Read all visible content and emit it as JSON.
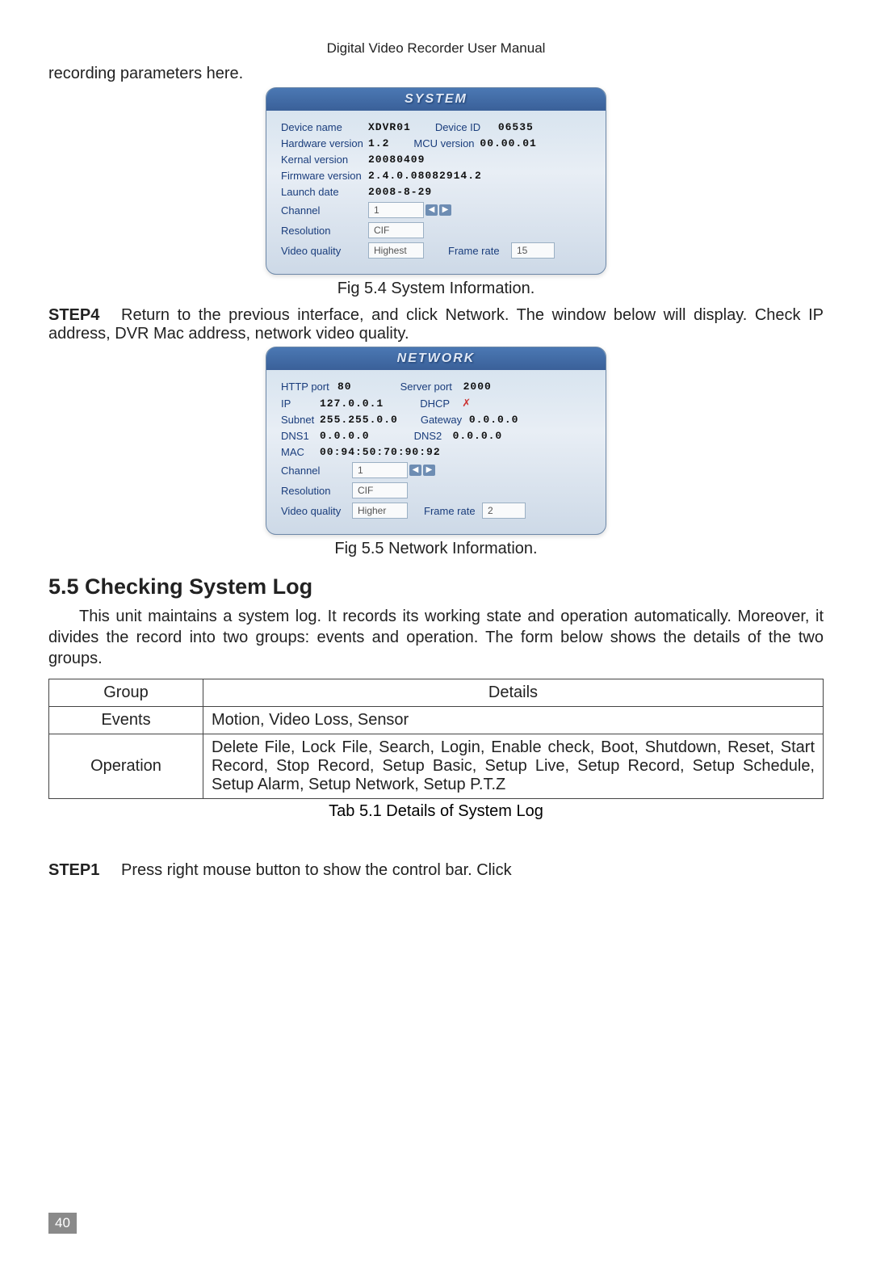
{
  "header": "Digital Video Recorder User Manual",
  "top_line": "recording parameters here.",
  "system": {
    "title": "SYSTEM",
    "device_name_lbl": "Device name",
    "device_name_val": "XDVR01",
    "device_id_lbl": "Device ID",
    "device_id_val": "06535",
    "hw_ver_lbl": "Hardware version",
    "hw_ver_val": "1.2",
    "mcu_ver_lbl": "MCU version",
    "mcu_ver_val": "00.00.01",
    "kernel_lbl": "Kernal version",
    "kernel_val": "20080409",
    "fw_lbl": "Firmware version",
    "fw_val": "2.4.0.08082914.2",
    "launch_lbl": "Launch date",
    "launch_val": "2008-8-29",
    "channel_lbl": "Channel",
    "channel_val": "1",
    "res_lbl": "Resolution",
    "res_val": "CIF",
    "vq_lbl": "Video quality",
    "vq_val": "Highest",
    "fr_lbl": "Frame rate",
    "fr_val": "15"
  },
  "fig54": "Fig 5.4    System Information.",
  "step4_lbl": "STEP4",
  "step4_text": "Return to the previous interface, and click Network. The window below will display. Check IP address, DVR Mac address, network video quality.",
  "network": {
    "title": "NETWORK",
    "http_lbl": "HTTP port",
    "http_val": "80",
    "srv_lbl": "Server port",
    "srv_val": "2000",
    "ip_lbl": "IP",
    "ip_val": "127.0.0.1",
    "dhcp_lbl": "DHCP",
    "subnet_lbl": "Subnet",
    "subnet_val": "255.255.0.0",
    "gw_lbl": "Gateway",
    "gw_val": "0.0.0.0",
    "dns1_lbl": "DNS1",
    "dns1_val": "0.0.0.0",
    "dns2_lbl": "DNS2",
    "dns2_val": "0.0.0.0",
    "mac_lbl": "MAC",
    "mac_val": "00:94:50:70:90:92",
    "channel_lbl": "Channel",
    "channel_val": "1",
    "res_lbl": "Resolution",
    "res_val": "CIF",
    "vq_lbl": "Video quality",
    "vq_val": "Higher",
    "fr_lbl": "Frame rate",
    "fr_val": "2"
  },
  "fig55": "Fig 5.5    Network Information.",
  "section_heading": "5.5  Checking System Log",
  "section_para": "This unit maintains a system log. It records its working state and operation automatically. Moreover, it divides the record into two groups: events and operation. The form below shows the details of the two groups.",
  "table": {
    "h1": "Group",
    "h2": "Details",
    "r1c1": "Events",
    "r1c2": "Motion, Video Loss, Sensor",
    "r2c1": "Operation",
    "r2c2": "Delete File, Lock File, Search, Login, Enable check, Boot, Shutdown, Reset, Start Record, Stop Record, Setup Basic, Setup Live, Setup Record, Setup Schedule, Setup Alarm, Setup Network, Setup P.T.Z"
  },
  "tab51": "Tab 5.1 Details of System Log",
  "step1_lbl": "STEP1",
  "step1_text": "Press right mouse button to show the control bar. Click",
  "page_number": "40"
}
